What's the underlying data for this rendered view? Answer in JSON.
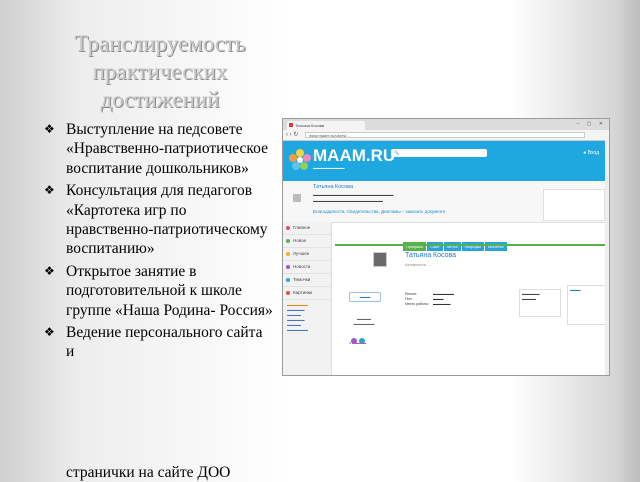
{
  "slide": {
    "title_lines": [
      "Транслируемость",
      "практических",
      "достижений"
    ],
    "bullets": [
      "Выступление на педсовете «Нравственно-патриотическое воспитание дошкольников»",
      "Консультация для педагогов «Картотека игр по нравственно-патриотическому воспитанию»",
      "Открытое занятие в подготовительной к школе группе «Наша Родина- Россия»",
      "Ведение персонального сайта и"
    ],
    "tail": "странички на сайте ДОО"
  },
  "screenshot": {
    "tab_title": "Татьяна Косова",
    "url": "www.maam.ru/users/...",
    "logo": "MAAM.RU",
    "login": "Вход",
    "banner": {
      "name": "Татьяна Косова",
      "promo": "Благодарности, Свидетельства, Дипломы – заказать документ!"
    },
    "sidebar_items": [
      "Главное",
      "Новое",
      "Лучшее",
      "Новости",
      "Темочки",
      "Картинки"
    ],
    "profile_tabs": [
      "Профиль",
      "Сайт",
      "Лента",
      "Награды",
      "Монетки"
    ],
    "profile_name": "Татьяна Косова",
    "profile_status": "Активность: ...",
    "info_labels": [
      "Регион:",
      "Пол:",
      "Место работы:"
    ]
  },
  "colors": {
    "site_blue": "#1fa8e0",
    "tab_green": "#58b14a",
    "link_blue": "#1f78c8"
  }
}
